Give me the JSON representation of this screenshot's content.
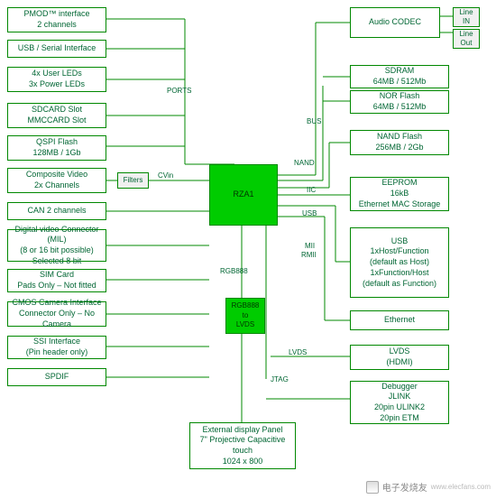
{
  "left": {
    "pmod": [
      "PMOD™ interface",
      "2 channels"
    ],
    "usb_serial": [
      "USB / Serial Interface"
    ],
    "user_leds": [
      "4x User LEDs",
      "3x Power LEDs"
    ],
    "sdcard": [
      "SDCARD Slot",
      "MMCCARD Slot"
    ],
    "qspi": [
      "QSPI Flash",
      "128MB / 1Gb"
    ],
    "composite": [
      "Composite Video",
      "2x Channels"
    ],
    "filters": [
      "Filters"
    ],
    "can": [
      "CAN 2 channels"
    ],
    "dvc": [
      "Digital video Connector (MIL)",
      "(8 or 16 bit possible)",
      "Selected 8 bit"
    ],
    "sim": [
      "SIM Card",
      "Pads Only – Not fitted"
    ],
    "cmos": [
      "CMOS Camera Interface",
      "Connector Only – No Camera"
    ],
    "ssi": [
      "SSI Interface",
      "(Pin header only)"
    ],
    "spdif": [
      "SPDIF"
    ]
  },
  "center": {
    "main": [
      "RZA1"
    ],
    "rgb_lvds": [
      "RGB888",
      "to",
      "LVDS"
    ],
    "disp": [
      "External display Panel",
      "7\" Projective Capacitive",
      "touch",
      "1024 x 800"
    ]
  },
  "right": {
    "audio": [
      "Audio CODEC"
    ],
    "line_in": [
      "Line",
      "IN"
    ],
    "line_out": [
      "Line",
      "Out"
    ],
    "sdram": [
      "SDRAM",
      "64MB / 512Mb"
    ],
    "nor": [
      "NOR Flash",
      "64MB / 512Mb"
    ],
    "nand": [
      "NAND Flash",
      "256MB / 2Gb"
    ],
    "eeprom": [
      "EEPROM",
      "16kB",
      "Ethernet MAC Storage"
    ],
    "usb": [
      "USB",
      "",
      "1xHost/Function",
      "(default as Host)",
      "1xFunction/Host",
      "(default as Function)"
    ],
    "eth": [
      "Ethernet"
    ],
    "lvds": [
      "LVDS",
      "(HDMI)"
    ],
    "debug": [
      "Debugger",
      "JLINK",
      "20pin ULINK2",
      "20pin ETM"
    ]
  },
  "labels": {
    "ports": "PORTS",
    "cvin": "CVin",
    "bus": "BUS",
    "nand": "NAND",
    "iic": "IIC",
    "usb": "USB",
    "mii": "MII",
    "rmii": "RMII",
    "rgb": "RGB888",
    "lvds": "LVDS",
    "jtag": "JTAG"
  },
  "watermark": {
    "brand": "电子发烧友",
    "url": "www.elecfans.com"
  }
}
